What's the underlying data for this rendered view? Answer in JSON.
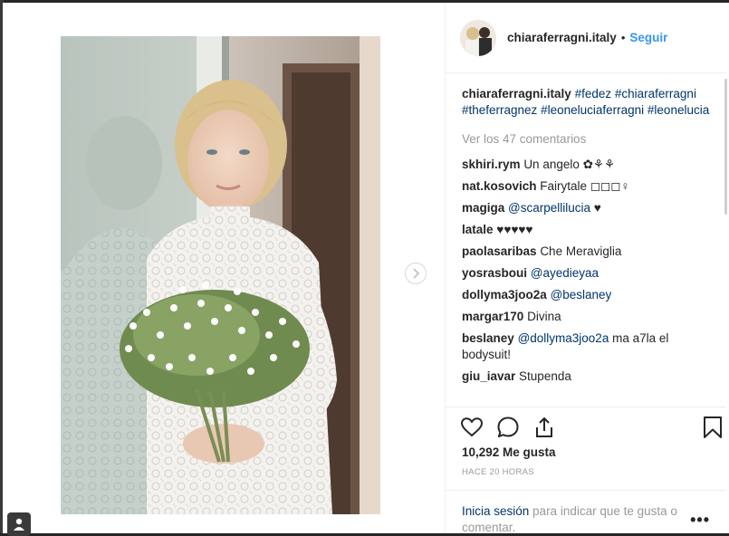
{
  "post": {
    "username": "chiaraferragni.italy",
    "follow_label": "Seguir",
    "header_separator": "•"
  },
  "caption": {
    "username": "chiaraferragni.italy",
    "hashtags": [
      "#fedez",
      "#chiaraferragni",
      "#theferragnez",
      "#leoneluciaferragni",
      "#leonelucia"
    ]
  },
  "view_all_comments": "Ver los 47 comentarios",
  "comments": [
    {
      "user": "skhiri.rym",
      "text": "Un angelo ✿⚘⚘"
    },
    {
      "user": "nat.kosovich",
      "text": "Fairytale ◻◻◻♀"
    },
    {
      "user": "magiga",
      "mention": "@scarpellilucia",
      "text": "♥"
    },
    {
      "user": "latale",
      "text": "♥♥♥♥♥"
    },
    {
      "user": "paolasaribas",
      "text": "Che Meraviglia"
    },
    {
      "user": "yosrasboui",
      "mention": "@ayedieyaa",
      "text": ""
    },
    {
      "user": "dollyma3joo2a",
      "mention": "@beslaney",
      "text": ""
    },
    {
      "user": "margar170",
      "text": "Divina"
    },
    {
      "user": "beslaney",
      "mention": "@dollyma3joo2a",
      "text": "ma a7la el bodysuit!"
    },
    {
      "user": "giu_iavar",
      "text": "Stupenda"
    }
  ],
  "actions": {
    "like_icon": "heart-icon",
    "comment_icon": "comment-icon",
    "share_icon": "share-icon",
    "save_icon": "bookmark-icon"
  },
  "likes_text": "10,292 Me gusta",
  "timestamp": "HACE 20 HORAS",
  "login_prompt": {
    "link": "Inicia sesión",
    "text": " para indicar que te gusta o comentar."
  },
  "more_options": "•••",
  "colors": {
    "link": "#003569",
    "follow": "#3897f0",
    "muted": "#999999",
    "text": "#262626"
  }
}
